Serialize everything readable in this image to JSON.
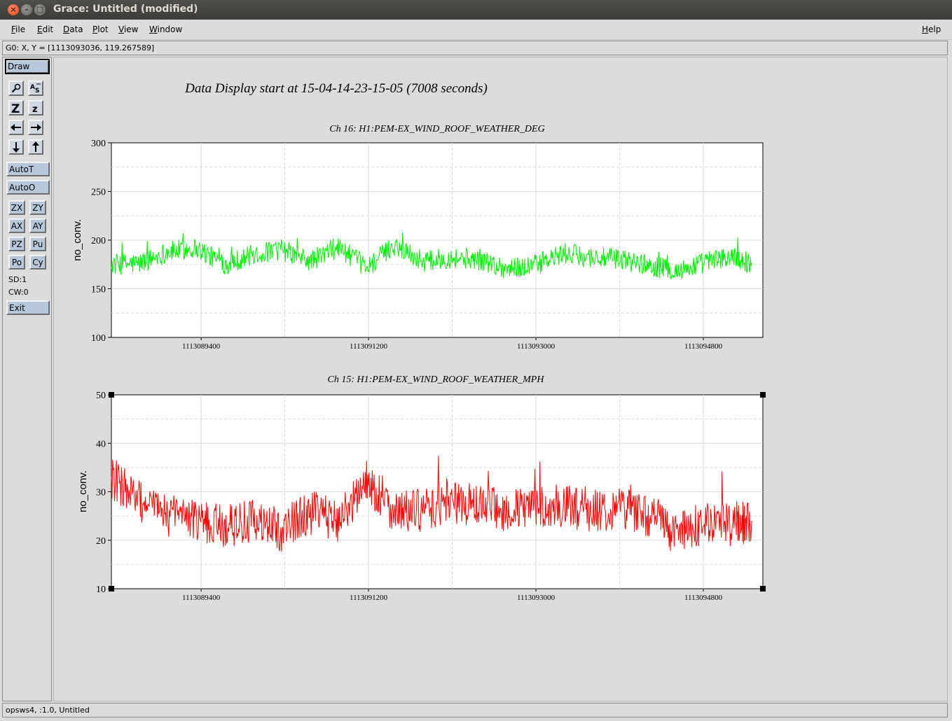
{
  "window": {
    "title": "Grace: Untitled (modified)"
  },
  "menu": {
    "file": "File",
    "edit": "Edit",
    "data": "Data",
    "plot": "Plot",
    "view": "View",
    "window": "Window",
    "help": "Help"
  },
  "locator": "G0: X, Y = [1113093036, 119.267589]",
  "toolbar": {
    "draw": "Draw",
    "autot": "AutoT",
    "autoo": "AutoO",
    "zx": "ZX",
    "zy": "ZY",
    "ax": "AX",
    "ay": "AY",
    "pz": "PZ",
    "pu": "Pu",
    "po": "Po",
    "cy": "Cy",
    "sd": "SD:1",
    "cw": "CW:0",
    "exit": "Exit",
    "icons": [
      "zoom-icon",
      "autoscale-text-icon",
      "zoom-in-icon",
      "zoom-out-icon",
      "left-arrow-icon",
      "right-arrow-icon",
      "down-arrow-icon",
      "up-arrow-icon"
    ]
  },
  "graph": {
    "title": "Data Display start at 15-04-14-23-15-05 (7008 seconds)"
  },
  "chart_data": [
    {
      "type": "line",
      "title": "Ch 16: H1:PEM-EX_WIND_ROOF_WEATHER_DEG",
      "xlabel": "",
      "ylabel": "no_conv.",
      "xlim": [
        1113088435,
        1113095440
      ],
      "ylim": [
        100,
        300
      ],
      "yticks": [
        100,
        150,
        200,
        250,
        300
      ],
      "xticks": [
        1113089400,
        1113091200,
        1113093000,
        1113094800
      ],
      "grid": true,
      "color": "#00ff00",
      "series": [
        {
          "x": [
            1113088435,
            1113088740,
            1113089045,
            1113089350,
            1113089654,
            1113089959,
            1113090264,
            1113090569,
            1113090874,
            1113091179,
            1113091484,
            1113091789,
            1113092094,
            1113092399,
            1113092704,
            1113093009,
            1113093314,
            1113093619,
            1113093924,
            1113094229,
            1113094534,
            1113094838,
            1113095143,
            1113095320
          ],
          "values": [
            175,
            176,
            188,
            192,
            175,
            185,
            190,
            178,
            193,
            172,
            195,
            178,
            182,
            180,
            170,
            175,
            186,
            182,
            180,
            174,
            168,
            178,
            183,
            175
          ]
        }
      ]
    },
    {
      "type": "line",
      "title": "Ch 15: H1:PEM-EX_WIND_ROOF_WEATHER_MPH",
      "xlabel": "",
      "ylabel": "no_conv.",
      "xlim": [
        1113088435,
        1113095440
      ],
      "ylim": [
        10,
        50
      ],
      "yticks": [
        10,
        20,
        30,
        40,
        50
      ],
      "xticks": [
        1113089400,
        1113091200,
        1113093000,
        1113094800
      ],
      "grid": true,
      "color": "#ff0000",
      "series": [
        {
          "x": [
            1113088435,
            1113088740,
            1113089045,
            1113089350,
            1113089654,
            1113089959,
            1113090264,
            1113090569,
            1113090874,
            1113091179,
            1113091484,
            1113091789,
            1113092094,
            1113092399,
            1113092704,
            1113093009,
            1113093314,
            1113093619,
            1113093924,
            1113094229,
            1113094534,
            1113094838,
            1113095143,
            1113095320
          ],
          "values": [
            33,
            28,
            25,
            24,
            23,
            24,
            22,
            26,
            24,
            32,
            26,
            26,
            28,
            27,
            26,
            27,
            27,
            26,
            27,
            25,
            21,
            24,
            23,
            24
          ]
        }
      ]
    }
  ],
  "status": "opsws4, :1.0, Untitled"
}
